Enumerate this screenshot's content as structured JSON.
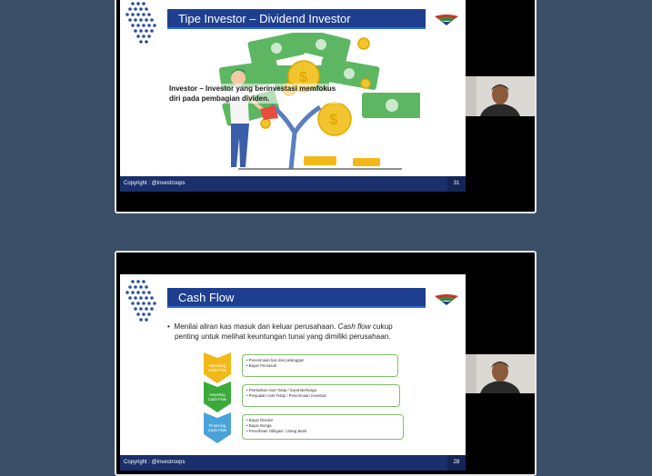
{
  "slide1": {
    "title": "Tipe Investor – Dividend Investor",
    "caption_line1": "Investor – Investor yang berinvestasi memfokus",
    "caption_line2": "diri pada pembagian dividen.",
    "footer": "Copyright : @investroops",
    "page": "31",
    "logo_icon": "brand-logo-icon"
  },
  "slide2": {
    "title": "Cash Flow",
    "bullet_line1_a": "Menilai aliran kas masuk dan keluar perusahaan. ",
    "bullet_line1_italic": "Cash flow",
    "bullet_line1_b": " cukup",
    "bullet_line2": "penting untuk melihat keuntungan tunai yang dimiliki perusahaan.",
    "rows": [
      {
        "label1": "Operating",
        "label2": "Cash Flow",
        "items": [
          "• Penerimaan kas dari pelanggan",
          "• Bayar Pemasok"
        ]
      },
      {
        "label1": "Investing",
        "label2": "Cash Flow",
        "items": [
          "• Pembelian Aset Tetap / Surat Berharga",
          "• Penjualan Aset Tetap / Penerimaan Investasi"
        ]
      },
      {
        "label1": "Financing",
        "label2": "Cash Flow",
        "items": [
          "• Bayar Dividen",
          "• Bayar Bunga",
          "• Penerbitan Obligasi / Utang Bank"
        ]
      }
    ],
    "footer": "Copyright : @investroops",
    "page": "28"
  },
  "colors": {
    "background": "#3b4f68",
    "title_bar": "#1e3f8f",
    "footer": "#1a2f6b",
    "operating": "#f2b818",
    "investing": "#3aaa3a",
    "financing": "#4aa3d8"
  }
}
